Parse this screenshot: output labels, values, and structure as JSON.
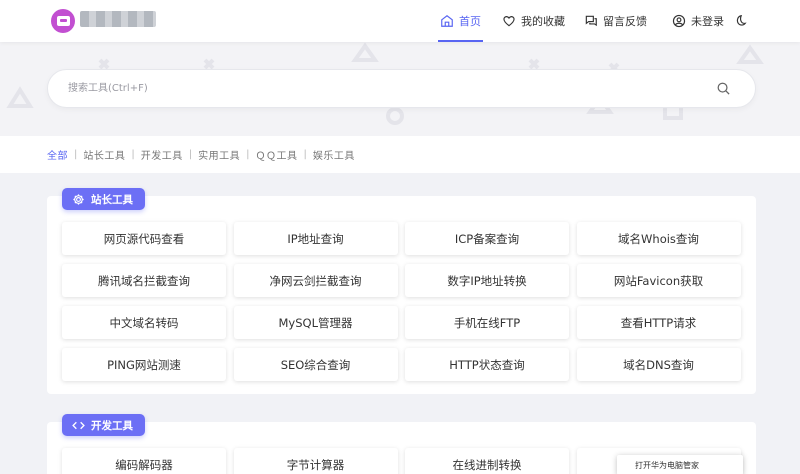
{
  "header": {
    "nav": [
      {
        "key": "home",
        "label": "首页",
        "active": true,
        "icon": "home-icon"
      },
      {
        "key": "favorites",
        "label": "我的收藏",
        "active": false,
        "icon": "heart-icon"
      },
      {
        "key": "feedback",
        "label": "留言反馈",
        "active": false,
        "icon": "chat-icon"
      },
      {
        "key": "login",
        "label": "未登录",
        "active": false,
        "icon": "user-icon"
      }
    ],
    "theme_toggle_icon": "moon-icon",
    "accent_color": "#5865f2"
  },
  "search": {
    "placeholder": "搜索工具(Ctrl+F)",
    "value": ""
  },
  "categories": [
    "全部",
    "站长工具",
    "开发工具",
    "实用工具",
    "ＱＱ工具",
    "娱乐工具"
  ],
  "active_category": "全部",
  "sections": [
    {
      "title": "站长工具",
      "icon": "gear-icon",
      "tools": [
        "网页源代码查看",
        "IP地址查询",
        "ICP备案查询",
        "域名Whois查询",
        "腾讯域名拦截查询",
        "净网云剑拦截查询",
        "数字IP地址转换",
        "网站Favicon获取",
        "中文域名转码",
        "MySQL管理器",
        "手机在线FTP",
        "查看HTTP请求",
        "PING网站测速",
        "SEO综合查询",
        "HTTP状态查询",
        "域名DNS查询"
      ]
    },
    {
      "title": "开发工具",
      "icon": "code-icon",
      "tools": [
        "编码解码器",
        "字节计算器",
        "在线进制转换",
        ""
      ]
    }
  ],
  "popup": {
    "text": "打开华为电脑管家"
  }
}
